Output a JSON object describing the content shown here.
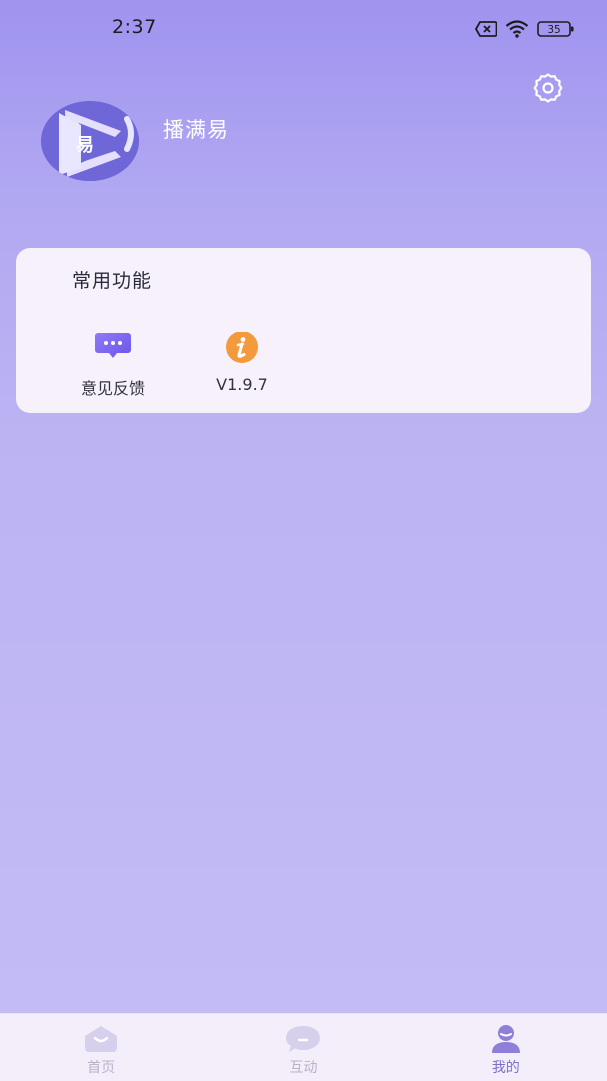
{
  "status_bar": {
    "time": "2:37",
    "battery": "35",
    "icons": [
      "sim-off-icon",
      "wifi-icon",
      "battery-icon"
    ]
  },
  "header": {
    "app_name": "播满易",
    "avatar_glyph": "易",
    "settings_icon": "gear-icon"
  },
  "common_functions": {
    "title": "常用功能",
    "items": [
      {
        "label": "意见反馈",
        "icon": "chat-bubble-icon"
      },
      {
        "label": "V1.9.7",
        "icon": "info-icon"
      }
    ]
  },
  "tabbar": {
    "items": [
      {
        "label": "首页",
        "icon": "home-icon",
        "active": false
      },
      {
        "label": "互动",
        "icon": "chat-icon",
        "active": false
      },
      {
        "label": "我的",
        "icon": "profile-icon",
        "active": true
      }
    ]
  },
  "colors": {
    "background_top": "#9f93ef",
    "background_bottom": "#c3bcf5",
    "accent": "#7b6fcb",
    "feedback_icon": "#7a63ef",
    "info_icon": "#f39a3c"
  }
}
